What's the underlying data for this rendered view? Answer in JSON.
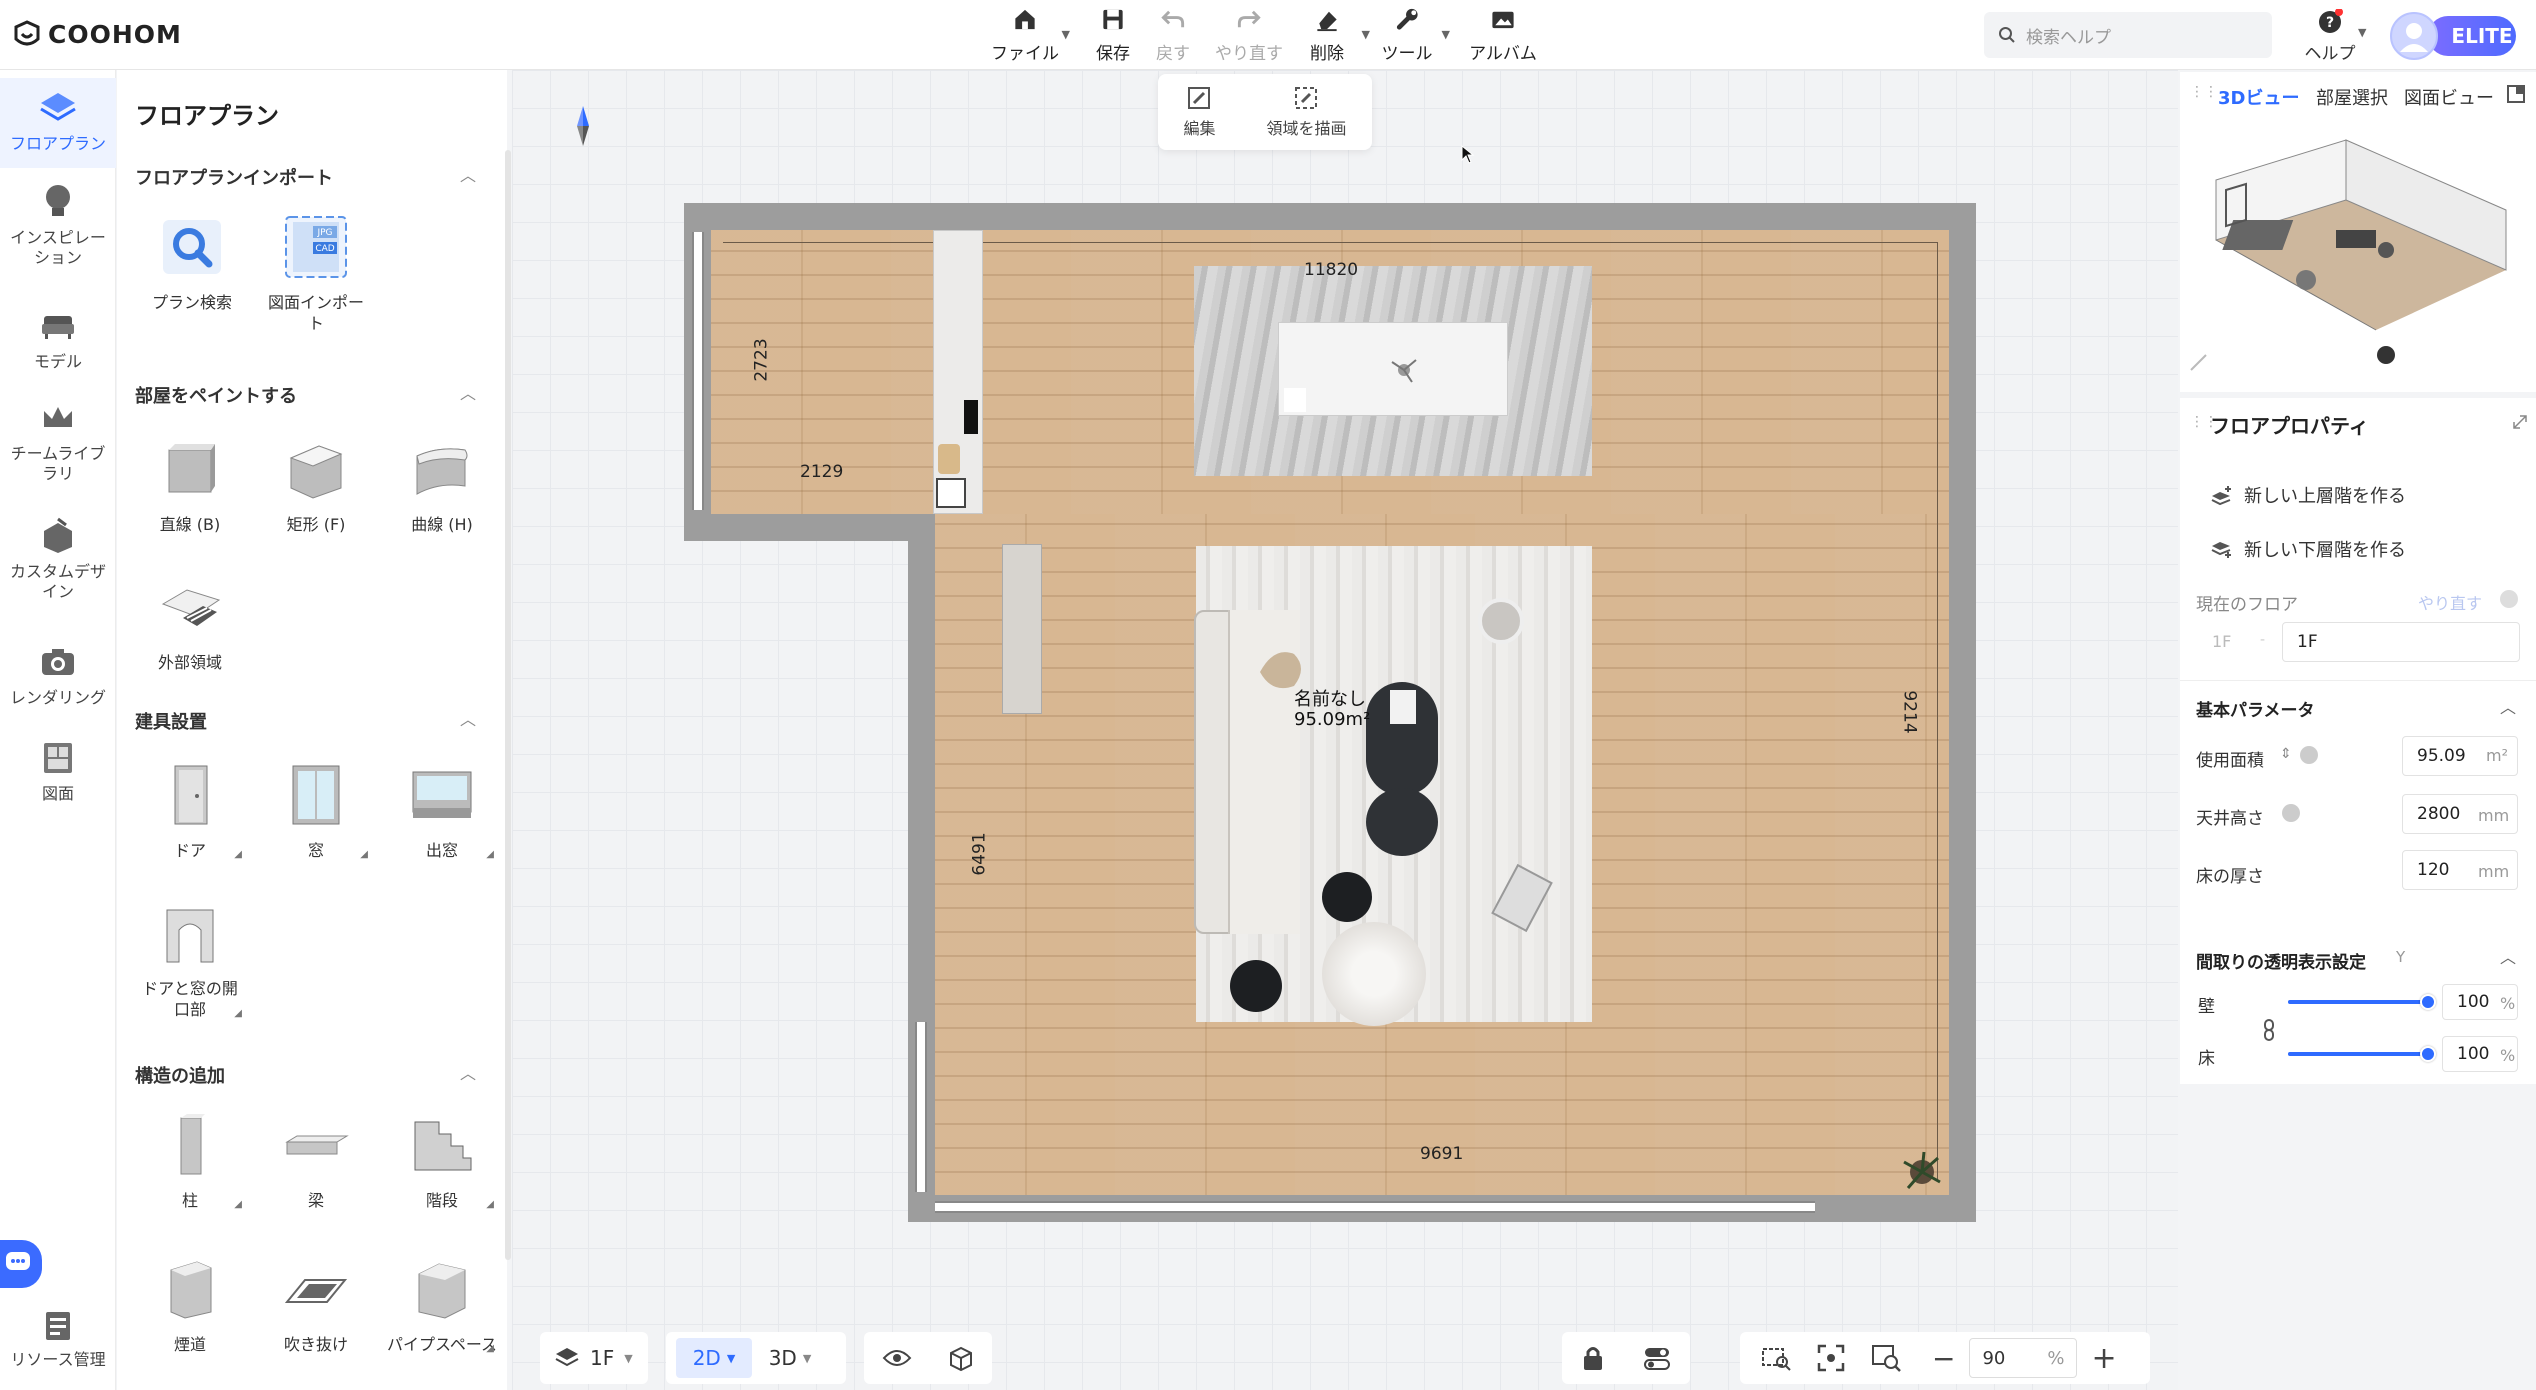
{
  "app": {
    "logo": "COOHOM"
  },
  "toolbar": {
    "file": "ファイル",
    "save": "保存",
    "undo": "戻す",
    "redo": "やり直す",
    "delete": "削除",
    "tools": "ツール",
    "album": "アルバム"
  },
  "search": {
    "placeholder": "検索ヘルプ"
  },
  "help": {
    "label": "ヘルプ"
  },
  "badge": {
    "label": "ELITE"
  },
  "leftnav": {
    "items": [
      {
        "label": "フロアプラン",
        "icon": "floorplan-icon"
      },
      {
        "label": "インスピレーション",
        "icon": "lightbulb-icon"
      },
      {
        "label": "モデル",
        "icon": "sofa-icon"
      },
      {
        "label": "チームライブラリ",
        "icon": "crown-icon"
      },
      {
        "label": "カスタムデザイン",
        "icon": "custom-design-icon"
      },
      {
        "label": "レンダリング",
        "icon": "camera-icon"
      },
      {
        "label": "図面",
        "icon": "drawing-icon"
      }
    ],
    "resource": "リソース管理"
  },
  "panel": {
    "title": "フロアプラン",
    "sections": {
      "import": {
        "title": "フロアプランインポート",
        "items": [
          "プラン検索",
          "図面インポート"
        ],
        "badges": [
          "JPG",
          "CAD"
        ]
      },
      "paint": {
        "title": "部屋をペイントする",
        "items": [
          "直線 (B)",
          "矩形 (F)",
          "曲線 (H)",
          "外部領域"
        ]
      },
      "fixtures": {
        "title": "建具設置",
        "items": [
          "ドア",
          "窓",
          "出窓",
          "ドアと窓の開口部"
        ]
      },
      "structure": {
        "title": "構造の追加",
        "items": [
          "柱",
          "梁",
          "階段",
          "煙道",
          "吹き抜け",
          "パイプスペース"
        ]
      }
    }
  },
  "canvas": {
    "floatbar": {
      "edit": "編集",
      "draw_area": "領域を描画"
    },
    "room": {
      "name": "名前なし",
      "area": "95.09m²"
    },
    "dimensions": [
      "11820",
      "2723",
      "2129",
      "9214",
      "6491",
      "9691"
    ]
  },
  "bottombar": {
    "floor": "1F",
    "mode2d": "2D",
    "mode3d": "3D",
    "zoom": "90",
    "zoom_unit": "%"
  },
  "rightpanel": {
    "tabs": [
      "3Dビュー",
      "部屋選択",
      "図面ビュー"
    ],
    "properties_title": "フロアプロパティ",
    "new_upper": "新しい上層階を作る",
    "new_lower": "新しい下層階を作る",
    "current_floor_label": "現在のフロア",
    "redo": "やり直す",
    "floor_prefix": "1F",
    "floor_value": "1F",
    "basic_title": "基本パラメータ",
    "area_label": "使用面積",
    "area_value": "95.09",
    "area_unit": "m²",
    "ceiling_label": "天井高さ",
    "ceiling_value": "2800",
    "ceiling_unit": "mm",
    "floor_thick_label": "床の厚さ",
    "floor_thick_value": "120",
    "floor_thick_unit": "mm",
    "transparency_title": "間取りの透明表示設定",
    "transparency_key": "Y",
    "wall_label": "壁",
    "wall_value": "100",
    "floor_label": "床",
    "floor_value_pct": "100",
    "pct": "%",
    "wall_level": 1.0,
    "floor_level": 1.0
  },
  "colors": {
    "accent": "#2e6bff",
    "wall": "#9d9d9d",
    "wood": "#d6b48e"
  }
}
